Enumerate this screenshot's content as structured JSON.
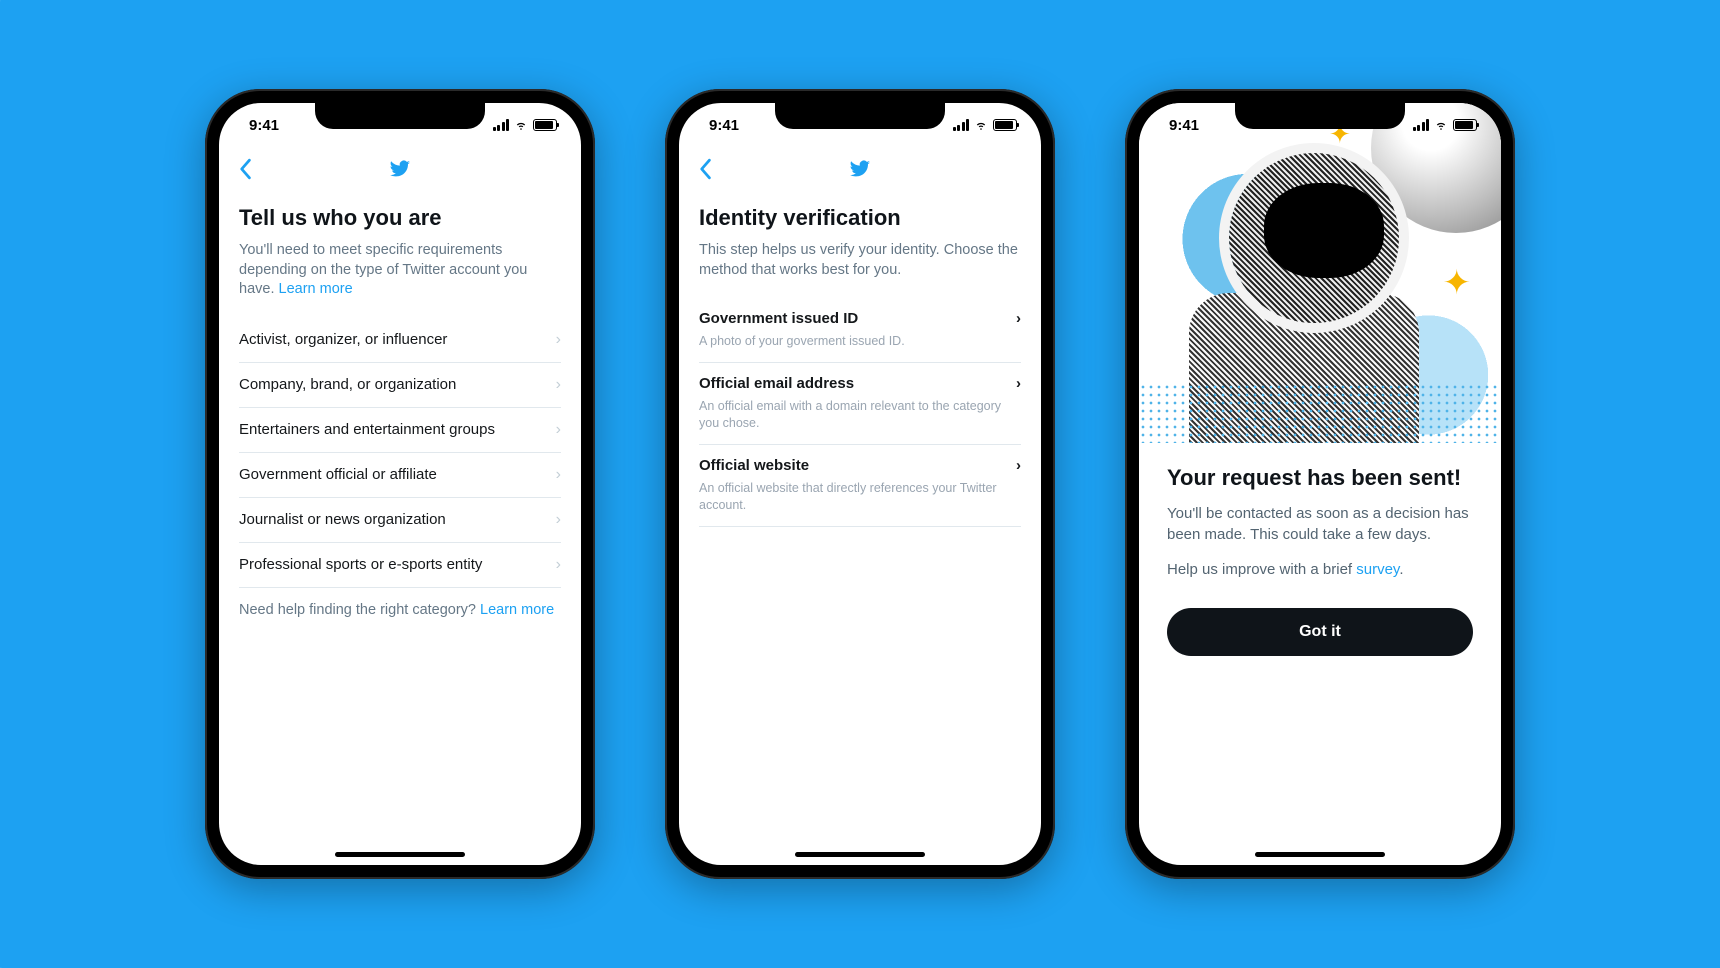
{
  "status": {
    "time": "9:41"
  },
  "screen1": {
    "title": "Tell us who you are",
    "subtitle_1": "You'll need to meet specific requirements depending on the type of Twitter account you have. ",
    "learn_more": "Learn more",
    "categories": [
      "Activist, organizer, or influencer",
      "Company, brand, or organization",
      "Entertainers and entertainment groups",
      "Government official or affiliate",
      "Journalist or news organization",
      "Professional sports or e-sports entity"
    ],
    "help_prefix": "Need help finding the right category? ",
    "help_link": "Learn more"
  },
  "screen2": {
    "title": "Identity verification",
    "subtitle": "This step helps us verify your identity. Choose the method that works best for you.",
    "options": [
      {
        "title": "Government issued ID",
        "desc": "A photo of your goverment issued ID."
      },
      {
        "title": "Official email address",
        "desc": "An official email with a domain relevant to the category you chose."
      },
      {
        "title": "Official website",
        "desc": "An official website that directly references your Twitter account."
      }
    ]
  },
  "screen3": {
    "title": "Your request has been sent!",
    "body": "You'll be contacted as soon as a decision has been made. This could take a few days.",
    "survey_prefix": "Help us improve with a brief ",
    "survey_link": "survey",
    "survey_suffix": ".",
    "button": "Got it"
  }
}
